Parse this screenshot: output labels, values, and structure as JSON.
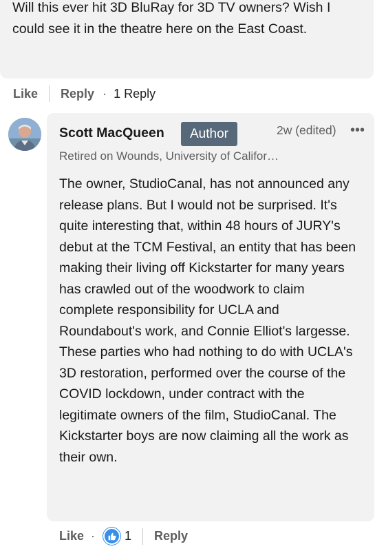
{
  "comment": {
    "text": "Will this ever hit 3D BluRay for 3D TV owners? Wish I could see it in the theatre here on the East Coast.",
    "actions": {
      "like": "Like",
      "reply": "Reply",
      "reply_count": "1 Reply"
    }
  },
  "reply": {
    "author_name": "Scott MacQueen",
    "badge": "Author",
    "timestamp": "2w (edited)",
    "more_icon": "•••",
    "headline": "Retired on Wounds, University of Califor…",
    "text": "The owner, StudioCanal, has not announced any release plans. But I would not be surprised. It's quite interesting that, within 48 hours of JURY's debut at the TCM Festival, an entity that has been making their living off Kickstarter for many years has crawled out of the woodwork to claim complete responsibility for UCLA and Roundabout's work, and Connie Elliot's largesse. These parties who had nothing to do with UCLA's 3D restoration, performed over the course of the COVID lockdown, under contract with the legitimate owners of the film, StudioCanal. The Kickstarter boys are now claiming all the work as their own.",
    "actions": {
      "like": "Like",
      "like_count": "1",
      "reply": "Reply"
    }
  },
  "colors": {
    "bubble": "#f2f2f2",
    "badge": "#56687a",
    "like_blue": "#378fe9",
    "muted_text": "#5e5e5e"
  },
  "icons": [
    "avatar",
    "more-horizontal-icon",
    "like-reaction-icon"
  ]
}
